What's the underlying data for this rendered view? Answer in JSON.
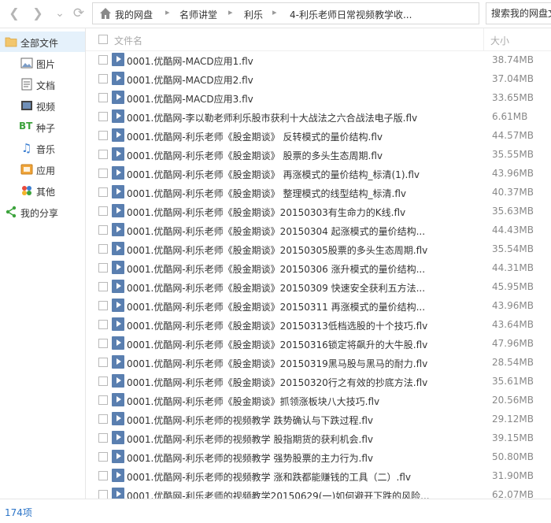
{
  "nav": {
    "back_icon": "back-arrow-icon",
    "forward_icon": "forward-arrow-icon",
    "refresh_icon": "refresh-icon"
  },
  "breadcrumb": [
    "我的网盘",
    "名师讲堂",
    "利乐",
    "4-利乐老师日常视频教学收..."
  ],
  "search": {
    "placeholder": "搜索我的网盘文件"
  },
  "sidebar": {
    "items": [
      {
        "label": "全部文件",
        "icon": "folder-icon"
      },
      {
        "label": "图片",
        "icon": "image-icon"
      },
      {
        "label": "文档",
        "icon": "document-icon"
      },
      {
        "label": "视频",
        "icon": "video-icon"
      },
      {
        "label": "种子",
        "icon": "bt-icon"
      },
      {
        "label": "音乐",
        "icon": "music-icon"
      },
      {
        "label": "应用",
        "icon": "app-icon"
      },
      {
        "label": "其他",
        "icon": "other-icon"
      },
      {
        "label": "我的分享",
        "icon": "share-icon"
      }
    ]
  },
  "list": {
    "headers": {
      "name": "文件名",
      "size": "大小"
    },
    "files": [
      {
        "name": "0001.优酷网-MACD应用1.flv",
        "size": "38.74MB"
      },
      {
        "name": "0001.优酷网-MACD应用2.flv",
        "size": "37.04MB"
      },
      {
        "name": "0001.优酷网-MACD应用3.flv",
        "size": "33.65MB"
      },
      {
        "name": "0001.优酷网-李以勒老师利乐股市获利十大战法之六合战法电子版.flv",
        "size": "6.61MB"
      },
      {
        "name": "0001.优酷网-利乐老师《股金期谈》 反转模式的量价结构.flv",
        "size": "44.57MB"
      },
      {
        "name": "0001.优酷网-利乐老师《股金期谈》 股票的多头生态周期.flv",
        "size": "35.55MB"
      },
      {
        "name": "0001.优酷网-利乐老师《股金期谈》 再涨模式的量价结构_标清(1).flv",
        "size": "43.96MB"
      },
      {
        "name": "0001.优酷网-利乐老师《股金期谈》 整理模式的线型结构_标清.flv",
        "size": "40.37MB"
      },
      {
        "name": "0001.优酷网-利乐老师《股金期谈》20150303有生命力的K线.flv",
        "size": "35.63MB"
      },
      {
        "name": "0001.优酷网-利乐老师《股金期谈》20150304 起涨模式的量价结构...",
        "size": "44.43MB"
      },
      {
        "name": "0001.优酷网-利乐老师《股金期谈》20150305股票的多头生态周期.flv",
        "size": "35.54MB"
      },
      {
        "name": "0001.优酷网-利乐老师《股金期谈》20150306 涨升模式的量价结构...",
        "size": "44.31MB"
      },
      {
        "name": "0001.优酷网-利乐老师《股金期谈》20150309 快速安全获利五方法...",
        "size": "45.95MB"
      },
      {
        "name": "0001.优酷网-利乐老师《股金期谈》20150311 再涨模式的量价结构...",
        "size": "43.96MB"
      },
      {
        "name": "0001.优酷网-利乐老师《股金期谈》20150313低档选股的十个技巧.flv",
        "size": "43.64MB"
      },
      {
        "name": "0001.优酷网-利乐老师《股金期谈》20150316锁定将飙升的大牛股.flv",
        "size": "47.96MB"
      },
      {
        "name": "0001.优酷网-利乐老师《股金期谈》20150319黑马股与黑马的耐力.flv",
        "size": "28.54MB"
      },
      {
        "name": "0001.优酷网-利乐老师《股金期谈》20150320行之有效的抄底方法.flv",
        "size": "35.61MB"
      },
      {
        "name": "0001.优酷网-利乐老师《股金期谈》抓领涨板块八大技巧.flv",
        "size": "20.56MB"
      },
      {
        "name": "0001.优酷网-利乐老师的视频教学 跌势确认与下跌过程.flv",
        "size": "29.12MB"
      },
      {
        "name": "0001.优酷网-利乐老师的视频教学 股指期货的获利机会.flv",
        "size": "39.15MB"
      },
      {
        "name": "0001.优酷网-利乐老师的视频教学 强势股票的主力行为.flv",
        "size": "50.80MB"
      },
      {
        "name": "0001.优酷网-利乐老师的视频教学 涨和跌都能赚钱的工具（二）.flv",
        "size": "31.90MB"
      },
      {
        "name": "0001.优酷网-利乐老师的视频教学20150629(一)如何避开下跌的风险...",
        "size": "62.07MB"
      }
    ]
  },
  "footer": {
    "count": "174项"
  },
  "colors": {
    "accent": "#2b74c7",
    "active_bg": "#e5f1fb",
    "file_icon": "#5a7fb0"
  }
}
